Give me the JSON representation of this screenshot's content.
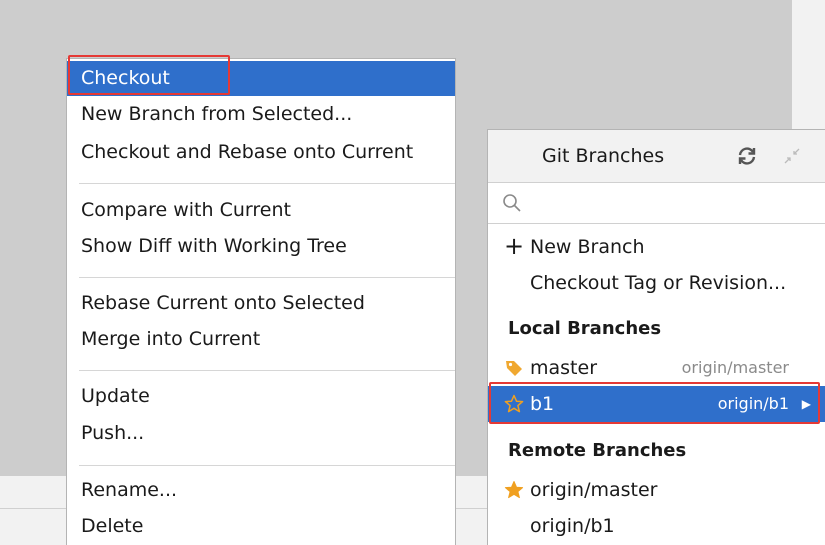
{
  "context_menu": {
    "items": [
      {
        "label": "Checkout",
        "selected": true
      },
      {
        "label": "New Branch from Selected..."
      },
      {
        "label": "Checkout and Rebase onto Current"
      },
      {
        "label": "Compare with Current"
      },
      {
        "label": "Show Diff with Working Tree"
      },
      {
        "label": "Rebase Current onto Selected"
      },
      {
        "label": "Merge into Current"
      },
      {
        "label": "Update"
      },
      {
        "label": "Push..."
      },
      {
        "label": "Rename..."
      },
      {
        "label": "Delete"
      }
    ]
  },
  "git_popup": {
    "title": "Git Branches",
    "search": {
      "value": "",
      "placeholder": ""
    },
    "actions": {
      "new_branch": "New Branch",
      "checkout_tag": "Checkout Tag or Revision..."
    },
    "local_header": "Local Branches",
    "local_branches": [
      {
        "name": "master",
        "remote": "origin/master",
        "icon": "tag-icon"
      },
      {
        "name": "b1",
        "remote": "origin/b1",
        "icon": "star-outline-icon",
        "selected": true
      }
    ],
    "remote_header": "Remote Branches",
    "remote_branches": [
      {
        "name": "origin/master",
        "icon": "star-filled-icon"
      },
      {
        "name": "origin/b1"
      }
    ]
  },
  "colors": {
    "selection": "#2f6fcb",
    "highlight_box": "#e53935",
    "tag": "#f0a830",
    "star": "#f0a020"
  }
}
